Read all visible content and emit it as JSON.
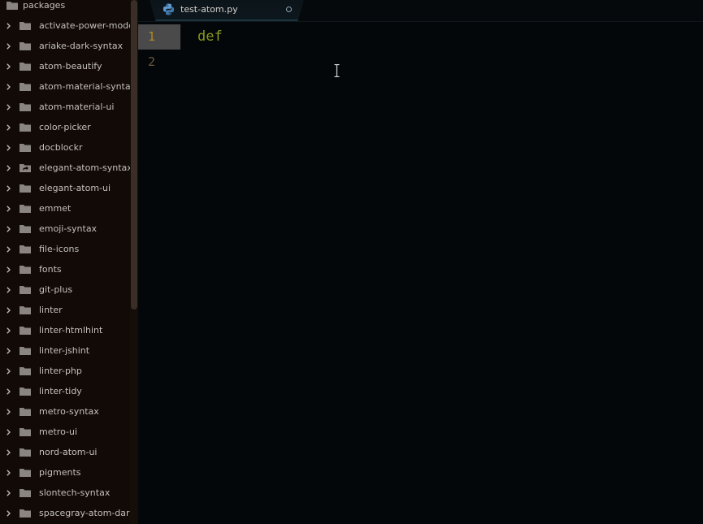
{
  "sidebar": {
    "root_label": "packages",
    "items": [
      {
        "label": "activate-power-mode",
        "icon": "folder-icon"
      },
      {
        "label": "ariake-dark-syntax",
        "icon": "folder-icon"
      },
      {
        "label": "atom-beautify",
        "icon": "folder-icon"
      },
      {
        "label": "atom-material-syntax",
        "icon": "folder-icon"
      },
      {
        "label": "atom-material-ui",
        "icon": "folder-icon"
      },
      {
        "label": "color-picker",
        "icon": "folder-icon"
      },
      {
        "label": "docblockr",
        "icon": "folder-icon"
      },
      {
        "label": "elegant-atom-syntax",
        "icon": "folder-symlink-icon"
      },
      {
        "label": "elegant-atom-ui",
        "icon": "folder-icon"
      },
      {
        "label": "emmet",
        "icon": "folder-icon"
      },
      {
        "label": "emoji-syntax",
        "icon": "folder-icon"
      },
      {
        "label": "file-icons",
        "icon": "folder-icon"
      },
      {
        "label": "fonts",
        "icon": "folder-icon"
      },
      {
        "label": "git-plus",
        "icon": "folder-icon"
      },
      {
        "label": "linter",
        "icon": "folder-icon"
      },
      {
        "label": "linter-htmlhint",
        "icon": "folder-icon"
      },
      {
        "label": "linter-jshint",
        "icon": "folder-icon"
      },
      {
        "label": "linter-php",
        "icon": "folder-icon"
      },
      {
        "label": "linter-tidy",
        "icon": "folder-icon"
      },
      {
        "label": "metro-syntax",
        "icon": "folder-icon"
      },
      {
        "label": "metro-ui",
        "icon": "folder-icon"
      },
      {
        "label": "nord-atom-ui",
        "icon": "folder-icon"
      },
      {
        "label": "pigments",
        "icon": "folder-icon"
      },
      {
        "label": "slontech-syntax",
        "icon": "folder-icon"
      },
      {
        "label": "spacegray-atom-dark-syntax",
        "icon": "folder-icon"
      }
    ]
  },
  "tab": {
    "title": "test-atom.py",
    "icon": "python-icon",
    "modified_indicator": "modified-dot-icon"
  },
  "editor": {
    "lines": [
      {
        "number": "1",
        "code": "def",
        "active": true
      },
      {
        "number": "2",
        "code": "",
        "active": false
      }
    ]
  },
  "colors": {
    "keyword": "#8a9a1a",
    "active_line_number": "#b08a22",
    "line_number": "#6b5a39",
    "sidebar_bg": "#110a06",
    "editor_bg": "#03070a"
  }
}
